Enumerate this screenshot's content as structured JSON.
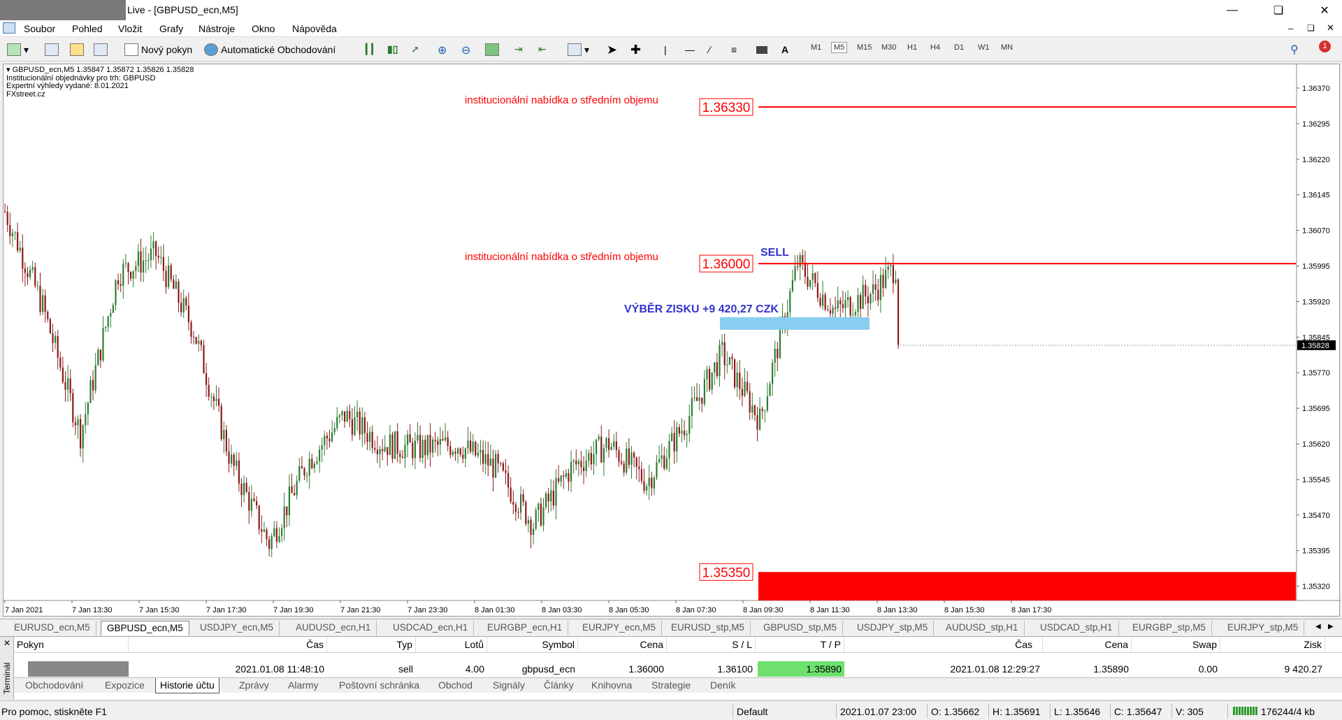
{
  "window": {
    "title": "Live - [GBPUSD_ecn,M5]",
    "controls": [
      "minimize-icon",
      "restore-icon",
      "close-icon"
    ]
  },
  "menu": [
    "Soubor",
    "Pohled",
    "Vložit",
    "Grafy",
    "Nástroje",
    "Okno",
    "Nápověda"
  ],
  "toolbar": {
    "new_order": "Nový pokyn",
    "auto_trading": "Automatické Obchodování",
    "timeframes": [
      "M1",
      "M5",
      "M15",
      "M30",
      "H1",
      "H4",
      "D1",
      "W1",
      "MN"
    ],
    "selected_timeframe": "M5",
    "text_tool": "A",
    "notification_count": "1"
  },
  "chart": {
    "info_lines": [
      "GBPUSD_ecn,M5  1.35847 1.35872 1.35826 1.35828",
      "Institucionální objednávky pro trh: GBPUSD",
      "Expertní výhledy vydané: 8.01.2021",
      "FXstreet.cz"
    ],
    "annotation_top": "institucionální nabídka o středním objemu",
    "annotation_mid": "institucionální nabídka o středním objemu",
    "level_top": "1.36330",
    "level_mid": "1.36000",
    "level_bottom": "1.35350",
    "sell_label": "SELL",
    "profit_label": "VÝBĚR ZISKU +9 420,27 CZK",
    "current_price": "1.35828",
    "colors": {
      "bull": "#2e7d32",
      "bear": "#8b1a1a",
      "level": "#ff0000",
      "zone": "#87cef0",
      "text_blue": "#3333cc"
    }
  },
  "chart_data": {
    "type": "candlestick",
    "symbol": "GBPUSD_ecn",
    "timeframe": "M5",
    "ylim": [
      1.3529,
      1.3642
    ],
    "y_ticks": [
      "1.36370",
      "1.36295",
      "1.36220",
      "1.36145",
      "1.36070",
      "1.35995",
      "1.35920",
      "1.35845",
      "1.35770",
      "1.35695",
      "1.35620",
      "1.35545",
      "1.35470",
      "1.35395",
      "1.35320"
    ],
    "x_ticks": [
      "7 Jan 2021",
      "7 Jan 13:30",
      "7 Jan 15:30",
      "7 Jan 17:30",
      "7 Jan 19:30",
      "7 Jan 21:30",
      "7 Jan 23:30",
      "8 Jan 01:30",
      "8 Jan 03:30",
      "8 Jan 05:30",
      "8 Jan 07:30",
      "8 Jan 09:30",
      "8 Jan 11:30",
      "8 Jan 13:30",
      "8 Jan 15:30",
      "8 Jan 17:30"
    ],
    "levels": [
      1.3633,
      1.36,
      1.3535
    ],
    "anchors": [
      [
        0,
        1.3611
      ],
      [
        15,
        1.3591
      ],
      [
        30,
        1.3564
      ],
      [
        45,
        1.3598
      ],
      [
        60,
        1.3602
      ],
      [
        75,
        1.3586
      ],
      [
        90,
        1.3558
      ],
      [
        105,
        1.3541
      ],
      [
        120,
        1.3558
      ],
      [
        135,
        1.3568
      ],
      [
        150,
        1.3562
      ],
      [
        165,
        1.3561
      ],
      [
        180,
        1.3562
      ],
      [
        195,
        1.3557
      ],
      [
        210,
        1.3545
      ],
      [
        225,
        1.3557
      ],
      [
        240,
        1.3562
      ],
      [
        255,
        1.3554
      ],
      [
        270,
        1.3566
      ],
      [
        285,
        1.3581
      ],
      [
        300,
        1.3567
      ],
      [
        315,
        1.36
      ],
      [
        330,
        1.359
      ],
      [
        345,
        1.3594
      ],
      [
        355,
        1.36
      ]
    ],
    "last": {
      "open": 1.35847,
      "high": 1.35872,
      "low": 1.35826,
      "close": 1.35828
    }
  },
  "chart_tabs": [
    "EURUSD_ecn,M5",
    "GBPUSD_ecn,M5",
    "USDJPY_ecn,M5",
    "AUDUSD_ecn,H1",
    "USDCAD_ecn,H1",
    "EURGBP_ecn,H1",
    "EURJPY_ecn,M5",
    "EURUSD_stp,M5",
    "GBPUSD_stp,M5",
    "USDJPY_stp,M5",
    "AUDUSD_stp,H1",
    "USDCAD_stp,H1",
    "EURGBP_stp,M5",
    "EURJPY_stp,M5"
  ],
  "active_chart_tab": "GBPUSD_ecn,M5",
  "terminal": {
    "side_label": "Terminál",
    "columns": [
      "Pokyn",
      "Čas",
      "Typ",
      "Lotů",
      "Symbol",
      "Cena",
      "S / L",
      "T / P",
      "Čas",
      "Cena",
      "Swap",
      "Zisk"
    ],
    "row": {
      "open_time": "2021.01.08 11:48:10",
      "type": "sell",
      "lots": "4.00",
      "symbol": "gbpusd_ecn",
      "price": "1.36000",
      "sl": "1.36100",
      "tp": "1.35890",
      "close_time": "2021.01.08 12:29:27",
      "close_price": "1.35890",
      "swap": "0.00",
      "profit": "9 420.27"
    },
    "tabs": [
      "Obchodování",
      "Expozice",
      "Historie účtu",
      "Zprávy",
      "Alarmy",
      "Poštovní schránka",
      "Obchod",
      "Signály",
      "Články",
      "Knihovna",
      "Strategie",
      "Deník"
    ],
    "active_tab": "Historie účtu"
  },
  "status": {
    "help": "Pro pomoc, stiskněte F1",
    "profile": "Default",
    "datetime": "2021.01.07 23:00",
    "open": "O: 1.35662",
    "high": "H: 1.35691",
    "low": "L: 1.35646",
    "close": "C: 1.35647",
    "volume": "V: 305",
    "traffic": "176244/4 kb"
  }
}
